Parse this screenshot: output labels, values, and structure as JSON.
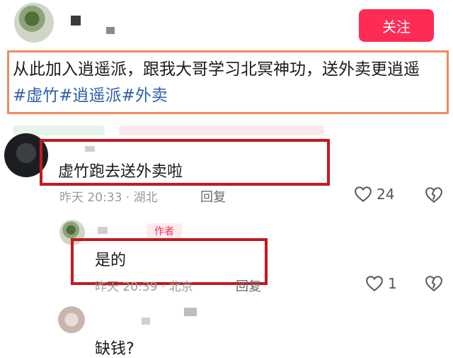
{
  "post": {
    "follow_label": "关注",
    "text_plain": "从此加入逍遥派，跟我大哥学习北冥神功，送外卖更逍遥",
    "hashtags": [
      "#虚竹",
      "#逍遥派",
      "#外卖"
    ]
  },
  "comments": [
    {
      "text": "虚竹跑去送外卖啦",
      "meta": "昨天 20:33 · 湖北",
      "reply_label": "回复",
      "likes": "24"
    },
    {
      "author_badge": "作者",
      "text": "是的",
      "meta": "昨天 20:39 · 北京",
      "reply_label": "回复",
      "likes": "1"
    },
    {
      "text": "缺钱?"
    }
  ],
  "colors": {
    "accent": "#fe2c55",
    "hashtag": "#2c5fa8",
    "highlight_box": "#c2191f",
    "post_box": "#f08a5d"
  }
}
